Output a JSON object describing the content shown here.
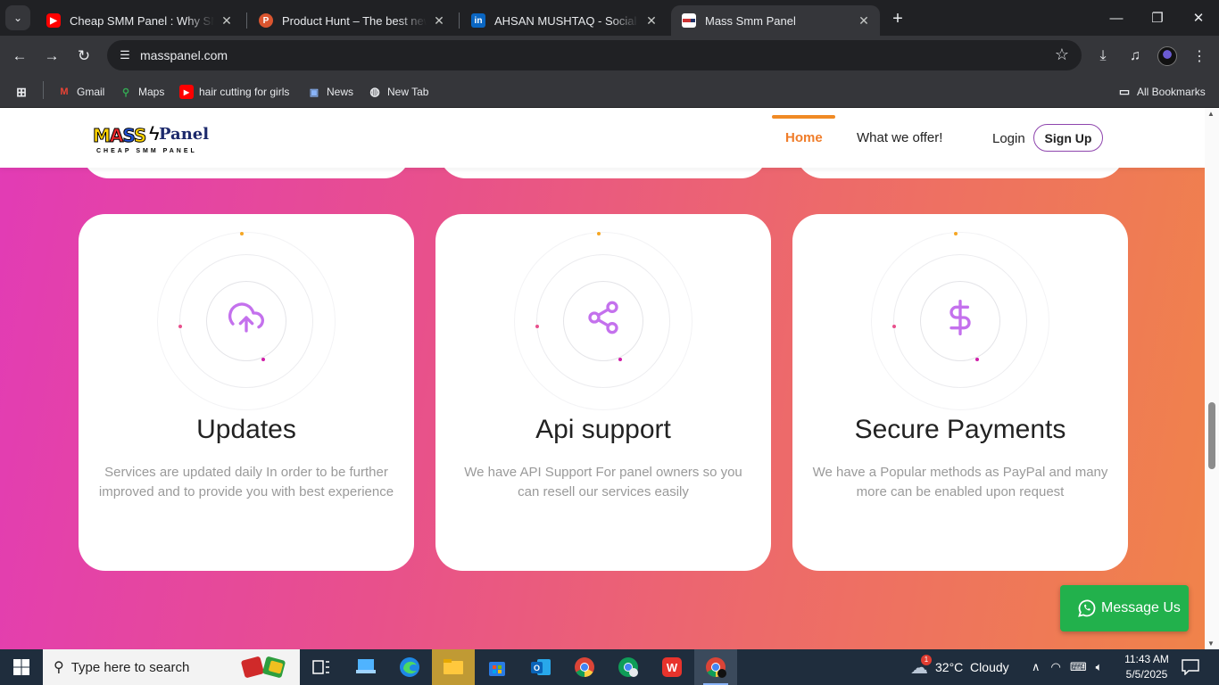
{
  "browser": {
    "tabs": [
      {
        "title": "Cheap SMM Panel : Why SMMG",
        "favicon": "youtube-icon",
        "active": false
      },
      {
        "title": "Product Hunt – The best new products",
        "favicon": "producthunt-icon",
        "active": false
      },
      {
        "title": "AHSAN MUSHTAQ - Social Media",
        "favicon": "linkedin-icon",
        "active": false
      },
      {
        "title": "Mass Smm Panel",
        "favicon": "masspanel-icon",
        "active": true
      }
    ],
    "url": "masspanel.com",
    "bookmarks": [
      {
        "label": "Gmail",
        "icon": "gmail-icon"
      },
      {
        "label": "Maps",
        "icon": "maps-icon"
      },
      {
        "label": "hair cutting for girls",
        "icon": "youtube-icon"
      },
      {
        "label": "News",
        "icon": "news-icon"
      },
      {
        "label": "New Tab",
        "icon": "globe-icon"
      }
    ],
    "all_bookmarks": "All Bookmarks"
  },
  "site": {
    "logo": {
      "word1": "MASS",
      "word2": "Panel",
      "tagline": "CHEAP SMM PANEL"
    },
    "nav": {
      "home": "Home",
      "offer": "What we offer!",
      "login": "Login",
      "signup": "Sign Up"
    },
    "features": [
      {
        "title": "Updates",
        "text": "Services are updated daily In order to be further improved and to provide you with best experience",
        "icon": "cloud-upload-icon"
      },
      {
        "title": "Api support",
        "text": "We have API Support For panel owners so you can resell our services easily",
        "icon": "share-icon"
      },
      {
        "title": "Secure Payments",
        "text": "We have a Popular methods as PayPal and many more can be enabled upon request",
        "icon": "dollar-icon"
      }
    ],
    "whatsapp": "Message Us"
  },
  "taskbar": {
    "search_placeholder": "Type here to search",
    "weather": "32°C  Cloudy",
    "weather_badge": "1",
    "time": "11:43 AM",
    "date": "5/5/2025"
  },
  "colors": {
    "accent_orange": "#f07d2a",
    "signup_border": "#8e44ad",
    "icon_purple": "#c471ed",
    "whatsapp_green": "#22b14c"
  }
}
